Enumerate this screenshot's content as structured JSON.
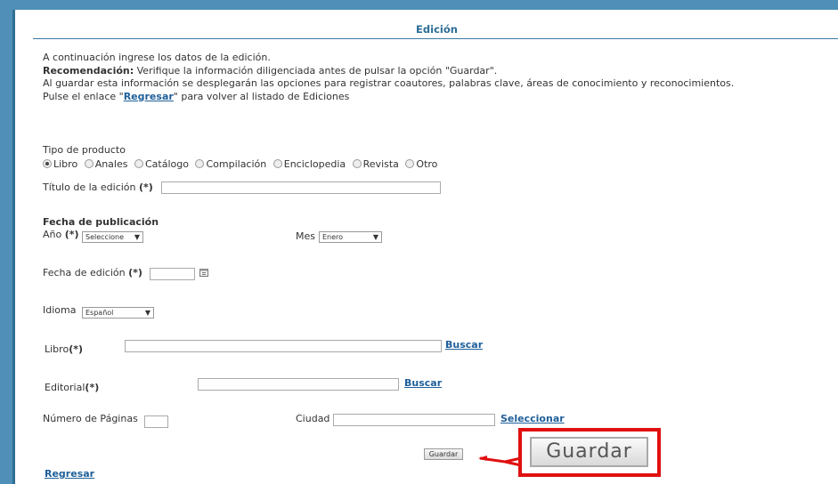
{
  "header": {
    "title": "Edición"
  },
  "intro": {
    "line1": "A continuación ingrese los datos de la edición.",
    "recommend_label": "Recomendación:",
    "recommend_text": " Verifique la información diligenciada antes de pulsar la opción \"Guardar\".",
    "line3": "Al guardar esta información se desplegarán las opciones para registrar coautores, palabras clave, áreas de conocimiento y reconocimientos.",
    "line4_pre": "Pulse el enlace \"",
    "line4_link": "Regresar",
    "line4_post": "\" para volver al listado de Ediciones"
  },
  "product_type": {
    "label": "Tipo de producto",
    "options": [
      "Libro",
      "Anales",
      "Catálogo",
      "Compilación",
      "Enciclopedia",
      "Revista",
      "Otro"
    ],
    "selected": "Libro"
  },
  "titulo": {
    "label": "Título de la edición",
    "req": "(*)",
    "value": ""
  },
  "fecha_pub": {
    "heading": "Fecha de publicación",
    "anio_label": "Año",
    "req": "(*)",
    "anio_value": "Seleccione",
    "mes_label": "Mes",
    "mes_value": "Enero"
  },
  "fecha_edicion": {
    "label": "Fecha de edición",
    "req": "(*)",
    "value": ""
  },
  "idioma": {
    "label": "Idioma",
    "value": "Español"
  },
  "libro": {
    "label": "Libro",
    "req": "(*)",
    "link": "Buscar"
  },
  "editorial": {
    "label": "Editorial",
    "req": "(*)",
    "link": "Buscar"
  },
  "paginas": {
    "label": "Número de Páginas",
    "value": ""
  },
  "ciudad": {
    "label": "Ciudad",
    "link": "Seleccionar",
    "value": ""
  },
  "actions": {
    "save": "Guardar",
    "save_zoom": "Guardar",
    "back": "Regresar"
  },
  "colors": {
    "accent": "#2c6d96",
    "link": "#1f5f9a",
    "highlight": "#e01010",
    "frame": "#4f8fb8"
  }
}
